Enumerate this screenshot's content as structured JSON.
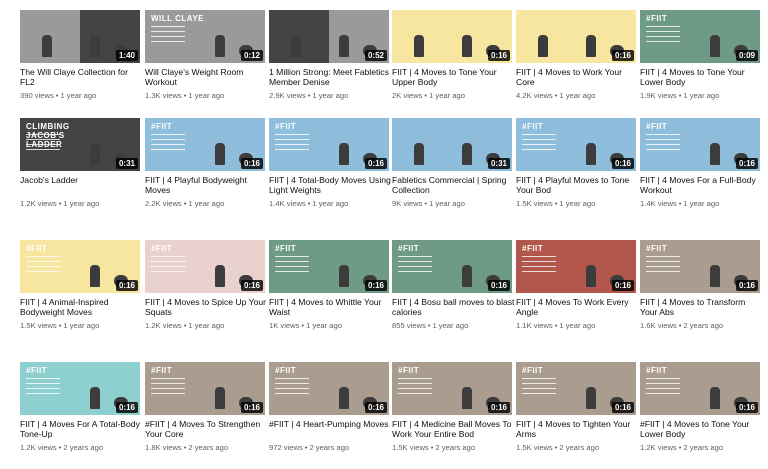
{
  "colors": {
    "yellow": "#f6e6a0",
    "blue": "#8ebedb",
    "green": "#6f9a86",
    "red": "#b3574d",
    "pink": "#e9d1cd",
    "taupe": "#aa9d90",
    "teal": "#8ecfcf",
    "gray": "#9a9a9a",
    "dark": "#444444"
  },
  "rows": [
    [
      {
        "title": "The Will Claye Collection for FL2",
        "views": "390 views",
        "age": "1 year ago",
        "duration": "1:40",
        "left": "gray",
        "right": "dark"
      },
      {
        "title": "Will Claye's Weight Room Workout",
        "views": "1.3K views",
        "age": "1 year ago",
        "duration": "0:12",
        "left": "gray",
        "right": "gray",
        "brand": "WILL CLAYE"
      },
      {
        "title": "1 Million Strong: Meet Fabletics Member Denise",
        "views": "2.9K views",
        "age": "1 year ago",
        "duration": "0:52",
        "left": "dark",
        "right": "gray"
      },
      {
        "title": "FIIT | 4 Moves to Tone Your Upper Body",
        "views": "2K views",
        "age": "1 year ago",
        "duration": "0:16",
        "left": "yellow",
        "right": "yellow"
      },
      {
        "title": "FIIT | 4 Moves to Work Your Core",
        "views": "4.2K views",
        "age": "1 year ago",
        "duration": "0:16",
        "left": "yellow",
        "right": "yellow"
      },
      {
        "title": "FIIT | 4 Moves to Tone Your Lower Body",
        "views": "1.9K views",
        "age": "1 year ago",
        "duration": "0:09",
        "left": "green",
        "right": "green",
        "brand": "#FIIT"
      }
    ],
    [
      {
        "title": "Jacob's Ladder",
        "views": "1.2K views",
        "age": "1 year ago",
        "duration": "0:31",
        "left": "dark",
        "right": "dark",
        "brand": "CLIMBING JACOB'S LADDER"
      },
      {
        "title": "FIIT | 4 Playful Bodyweight Moves",
        "views": "2.2K views",
        "age": "1 year ago",
        "duration": "0:16",
        "left": "blue",
        "right": "blue",
        "brand": "#FIIT"
      },
      {
        "title": "FIIT | 4 Total-Body Moves Using Light Weights",
        "views": "1.4K views",
        "age": "1 year ago",
        "duration": "0:16",
        "left": "blue",
        "right": "blue",
        "brand": "#FIIT"
      },
      {
        "title": "Fabletics Commercial | Spring Collection",
        "views": "9K views",
        "age": "1 year ago",
        "duration": "0:31",
        "left": "blue",
        "right": "blue"
      },
      {
        "title": "FIIT | 4 Playful Moves to Tone Your Bod",
        "views": "1.5K views",
        "age": "1 year ago",
        "duration": "0:16",
        "left": "blue",
        "right": "blue",
        "brand": "#FIIT"
      },
      {
        "title": "FIIT | 4 Moves For a Full-Body Workout",
        "views": "1.4K views",
        "age": "1 year ago",
        "duration": "0:16",
        "left": "blue",
        "right": "blue",
        "brand": "#FIIT"
      }
    ],
    [
      {
        "title": "FIIT | 4 Animal-Inspired Bodyweight Moves",
        "views": "1.5K views",
        "age": "1 year ago",
        "duration": "0:16",
        "left": "yellow",
        "right": "yellow",
        "brand": "#FIIT"
      },
      {
        "title": "FIIT | 4 Moves to Spice Up Your Squats",
        "views": "1.2K views",
        "age": "1 year ago",
        "duration": "0:16",
        "left": "pink",
        "right": "pink",
        "brand": "#FIIT"
      },
      {
        "title": "FIIT | 4 Moves to Whittle Your Waist",
        "views": "1K views",
        "age": "1 year ago",
        "duration": "0:16",
        "left": "green",
        "right": "green",
        "brand": "#FIIT"
      },
      {
        "title": "FIIT | 4 Bosu ball moves to blast calories",
        "views": "855 views",
        "age": "1 year ago",
        "duration": "0:16",
        "left": "green",
        "right": "green",
        "brand": "#FIIT"
      },
      {
        "title": "FIIT | 4 Moves To Work Every Angle",
        "views": "1.1K views",
        "age": "1 year ago",
        "duration": "0:16",
        "left": "red",
        "right": "red",
        "brand": "#FIIT"
      },
      {
        "title": "FIIT | 4 Moves to Transform Your Abs",
        "views": "1.6K views",
        "age": "2 years ago",
        "duration": "0:16",
        "left": "taupe",
        "right": "taupe",
        "brand": "#FIIT"
      }
    ],
    [
      {
        "title": "FIIT | 4 Moves For A Total-Body Tone-Up",
        "views": "1.2K views",
        "age": "2 years ago",
        "duration": "0:16",
        "left": "teal",
        "right": "teal",
        "brand": "#FIIT"
      },
      {
        "title": "#FIIT | 4 Moves To Strengthen Your Core",
        "views": "1.8K views",
        "age": "2 years ago",
        "duration": "0:16",
        "left": "taupe",
        "right": "taupe",
        "brand": "#FIIT"
      },
      {
        "title": "#FIIT | 4 Heart-Pumping Moves",
        "views": "972 views",
        "age": "2 years ago",
        "duration": "0:16",
        "left": "taupe",
        "right": "taupe",
        "brand": "#FIIT"
      },
      {
        "title": "FIIT | 4 Medicine Ball Moves To Work Your Entire Bod",
        "views": "1.5K views",
        "age": "2 years ago",
        "duration": "0:16",
        "left": "taupe",
        "right": "taupe",
        "brand": "#FIIT"
      },
      {
        "title": "FIIT | 4 Moves to Tighten Your Arms",
        "views": "1.5K views",
        "age": "2 years ago",
        "duration": "0:16",
        "left": "taupe",
        "right": "taupe",
        "brand": "#FIIT"
      },
      {
        "title": "#FIIT | 4 Moves to Tone Your Lower Body",
        "views": "1.2K views",
        "age": "2 years ago",
        "duration": "0:16",
        "left": "taupe",
        "right": "taupe",
        "brand": "#FIIT"
      }
    ]
  ]
}
